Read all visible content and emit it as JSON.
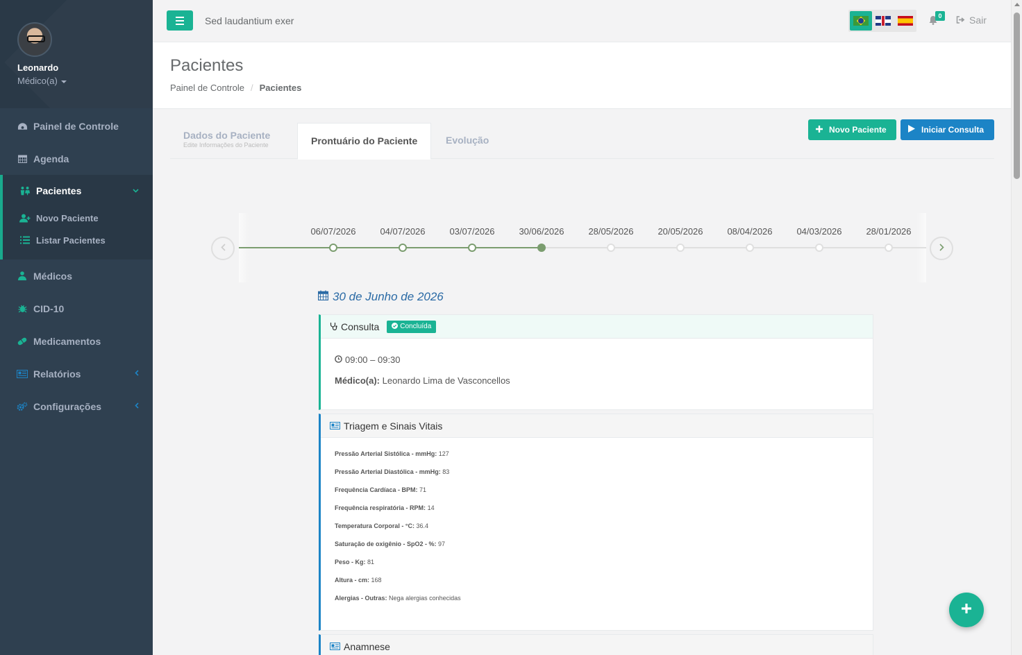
{
  "sidebar": {
    "user_name": "Leonardo",
    "user_role": "Médico(a)",
    "items": [
      {
        "label": "Painel de Controle",
        "icon": "dashboard-icon"
      },
      {
        "label": "Agenda",
        "icon": "calendar-icon"
      },
      {
        "label": "Pacientes",
        "icon": "patients-icon",
        "active": true,
        "children": [
          {
            "label": "Novo Paciente",
            "icon": "add-user-icon"
          },
          {
            "label": "Listar Pacientes",
            "icon": "list-icon"
          }
        ]
      },
      {
        "label": "Médicos",
        "icon": "doctor-icon"
      },
      {
        "label": "CID-10",
        "icon": "bug-icon"
      },
      {
        "label": "Medicamentos",
        "icon": "pill-icon"
      },
      {
        "label": "Relatórios",
        "icon": "report-icon"
      },
      {
        "label": "Configurações",
        "icon": "gears-icon"
      }
    ]
  },
  "topbar": {
    "search_text": "Sed laudantium exer",
    "notifications_count": "0",
    "logout_label": "Sair",
    "languages": [
      "Português",
      "English",
      "Español"
    ]
  },
  "page": {
    "title": "Pacientes",
    "breadcrumb": [
      "Painel de Controle",
      "Pacientes"
    ]
  },
  "tabs": [
    {
      "label": "Dados do Paciente",
      "sublabel": "Edite Informações do Paciente"
    },
    {
      "label": "Prontuário do Paciente",
      "active": true
    },
    {
      "label": "Evolução"
    }
  ],
  "actions": {
    "new_patient": "Novo Paciente",
    "start_consult": "Iniciar Consulta"
  },
  "timeline": {
    "dates": [
      "06/07/2026",
      "04/07/2026",
      "03/07/2026",
      "30/06/2026",
      "28/05/2026",
      "20/05/2026",
      "08/04/2026",
      "04/03/2026",
      "28/01/2026"
    ],
    "current_index": 3
  },
  "record": {
    "day_title": "30 de Junho de 2026",
    "consulta": {
      "title": "Consulta",
      "status": "Concluída",
      "time": "09:00 – 09:30",
      "doctor_label": "Médico(a):",
      "doctor_name": "Leonardo Lima de Vasconcellos"
    },
    "triagem": {
      "title": "Triagem e Sinais Vitais",
      "vitals": [
        {
          "label": "Pressão Arterial Sistólica - mmHg:",
          "value": "127"
        },
        {
          "label": "Pressão Arterial Diastólica - mmHg:",
          "value": "83"
        },
        {
          "label": "Frequência Cardíaca - BPM:",
          "value": "71"
        },
        {
          "label": "Frequência respiratória - RPM:",
          "value": "14"
        },
        {
          "label": "Temperatura Corporal - °C:",
          "value": "36.4"
        },
        {
          "label": "Saturação de oxigênio - SpO2 - %:",
          "value": "97"
        },
        {
          "label": "Peso - Kg:",
          "value": "81"
        },
        {
          "label": "Altura - cm:",
          "value": "168"
        },
        {
          "label": "Alergias - Outras:",
          "value": "Nega alergias conhecidas"
        }
      ]
    },
    "anamnese": {
      "title": "Anamnese"
    }
  },
  "colors": {
    "primary": "#1ab394",
    "info": "#1c84c6",
    "sidebar": "#2f4050",
    "timeline_done": "#7b9d6f"
  }
}
